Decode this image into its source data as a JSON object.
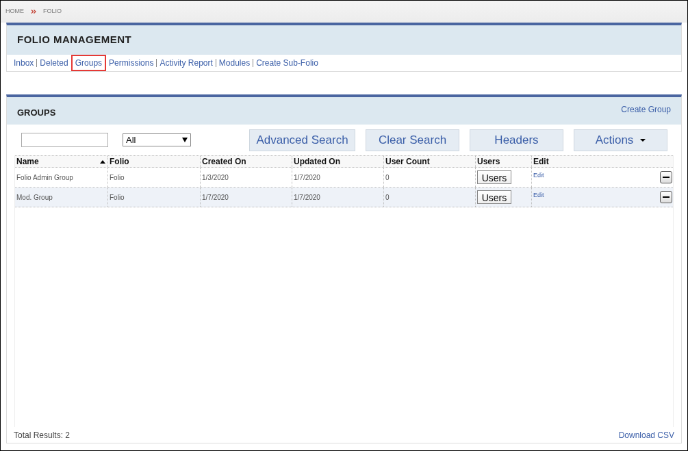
{
  "breadcrumb": [
    "HOME",
    "FOLIO"
  ],
  "management": {
    "title": "FOLIO MANAGEMENT",
    "links": [
      {
        "label": "Inbox",
        "selected": false
      },
      {
        "label": "Deleted",
        "selected": false
      },
      {
        "label": "Groups",
        "selected": true
      },
      {
        "label": "Permissions",
        "selected": false
      },
      {
        "label": "Activity Report",
        "selected": false
      },
      {
        "label": "Modules",
        "selected": false
      },
      {
        "label": "Create Sub-Folio",
        "selected": false
      }
    ]
  },
  "groups": {
    "title": "GROUPS",
    "create_link": "Create Group",
    "filter": {
      "value": "All"
    },
    "buttons": [
      "Advanced Search",
      "Clear Search",
      "Headers",
      "Actions"
    ],
    "table": {
      "columns": [
        {
          "label": "Name",
          "sorted": true
        },
        {
          "label": "Folio",
          "sorted": false
        },
        {
          "label": "Created On",
          "sorted": false
        },
        {
          "label": "Updated On",
          "sorted": false
        },
        {
          "label": "User Count",
          "sorted": false
        },
        {
          "label": "Users",
          "sorted": false
        },
        {
          "label": "Edit",
          "sorted": false
        }
      ],
      "rows": [
        {
          "name": "Folio Admin Group",
          "folio": "Folio",
          "created": "1/3/2020",
          "updated": "1/7/2020",
          "user_count": "0",
          "users_button": "Users",
          "edit": "Edit"
        },
        {
          "name": "Mod. Group",
          "folio": "Folio",
          "created": "1/7/2020",
          "updated": "1/7/2020",
          "user_count": "0",
          "users_button": "Users",
          "edit": "Edit"
        }
      ]
    },
    "total": "Total Results: 2",
    "download": "Download CSV"
  }
}
